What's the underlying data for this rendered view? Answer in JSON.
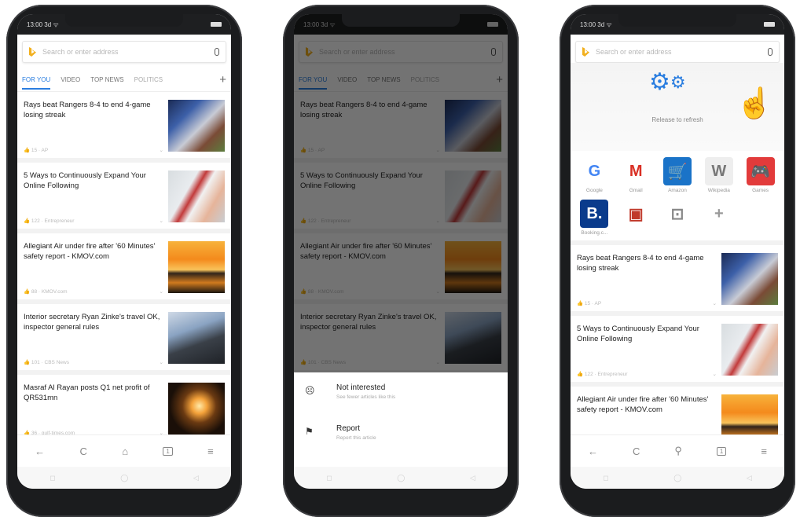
{
  "status": {
    "time": "13:00 3d ᯤ"
  },
  "search": {
    "placeholder": "Search or enter address"
  },
  "tabs": [
    "FOR YOU",
    "VIDEO",
    "TOP NEWS",
    "POLITICS",
    "+"
  ],
  "news": [
    {
      "title": "Rays beat Rangers 8-4 to end 4-game losing streak",
      "meta": "👍 15 · AP"
    },
    {
      "title": "5 Ways to Continuously Expand Your Online Following",
      "meta": "👍 122 · Entrepreneur"
    },
    {
      "title": "Allegiant Air under fire after '60 Minutes' safety report - KMOV.com",
      "meta": "👍 88 · KMOV.com"
    },
    {
      "title": "Interior secretary Ryan Zinke's travel OK, inspector general rules",
      "meta": "👍 101 · CBS News"
    },
    {
      "title": "Masraf Al Rayan posts Q1 net profit of QR531mn",
      "meta": "👍 36 · gulf-times.com"
    }
  ],
  "nav": {
    "back": "←",
    "reload": "C",
    "home": "⌂",
    "search": "⚲",
    "tabs": "1",
    "menu": "≡"
  },
  "sysnav": [
    "◻",
    "◯",
    "◁"
  ],
  "sheet": {
    "not_interested": "Not interested",
    "not_interested_sub": "See fewer articles like this",
    "report": "Report",
    "report_sub": "Report this article"
  },
  "refresh": {
    "label": "Release to refresh"
  },
  "speed_dials": [
    {
      "label": "Google",
      "glyph": "G",
      "color": "#4285f4",
      "bg": "#ffffff"
    },
    {
      "label": "Gmail",
      "glyph": "M",
      "color": "#d93025",
      "bg": "#ffffff"
    },
    {
      "label": "Amazon",
      "glyph": "🛒",
      "color": "#ffffff",
      "bg": "#1a73c8"
    },
    {
      "label": "Wikipedia",
      "glyph": "W",
      "color": "#777777",
      "bg": "#eeeeee"
    },
    {
      "label": "Games",
      "glyph": "🎮",
      "color": "#ffffff",
      "bg": "#e23b3b"
    },
    {
      "label": "Booking.c...",
      "glyph": "B.",
      "color": "#ffffff",
      "bg": "#0a3b8c"
    },
    {
      "label": "",
      "glyph": "▣",
      "color": "#c0392b",
      "bg": "#ffffff"
    },
    {
      "label": "",
      "glyph": "⊡",
      "color": "#888888",
      "bg": "#ffffff"
    },
    {
      "label": "",
      "glyph": "+",
      "color": "#999999",
      "bg": "#ffffff"
    }
  ]
}
